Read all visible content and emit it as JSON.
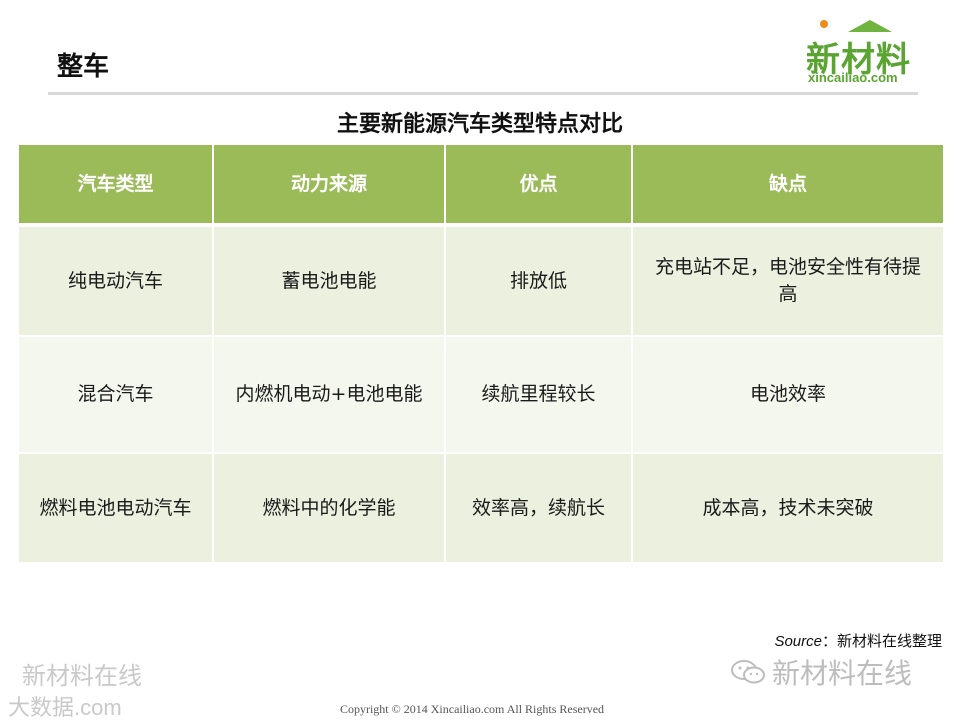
{
  "header": {
    "title": "整车",
    "logo_cn": "新材料",
    "logo_en": "xincailiao.com"
  },
  "table": {
    "title": "主要新能源汽车类型特点对比",
    "columns": [
      "汽车类型",
      "动力来源",
      "优点",
      "缺点"
    ],
    "rows": [
      [
        "纯电动汽车",
        "蓄电池电能",
        "排放低",
        "充电站不足，电池安全性有待提高"
      ],
      [
        "混合汽车",
        "内燃机电动+电池电能",
        "续航里程较长",
        "电池效率"
      ],
      [
        "燃料电池电动汽车",
        "燃料中的化学能",
        "效率高，续航长",
        "成本高，技术未突破"
      ]
    ]
  },
  "source": {
    "label": "Source",
    "text": "：新材料在线整理"
  },
  "watermarks": {
    "left_cn": "新材料在线",
    "left_en": "大数据.com",
    "right": "新材料在线"
  },
  "footer": {
    "copyright": "Copyright © 2014   Xincailiao.com    All Rights Reserved"
  },
  "colors": {
    "header_green": "#9bbb59",
    "row_light": "#ebf0df",
    "row_lighter": "#f4f7ee",
    "logo_green": "#5aa532",
    "logo_dot": "#f08a1c"
  }
}
